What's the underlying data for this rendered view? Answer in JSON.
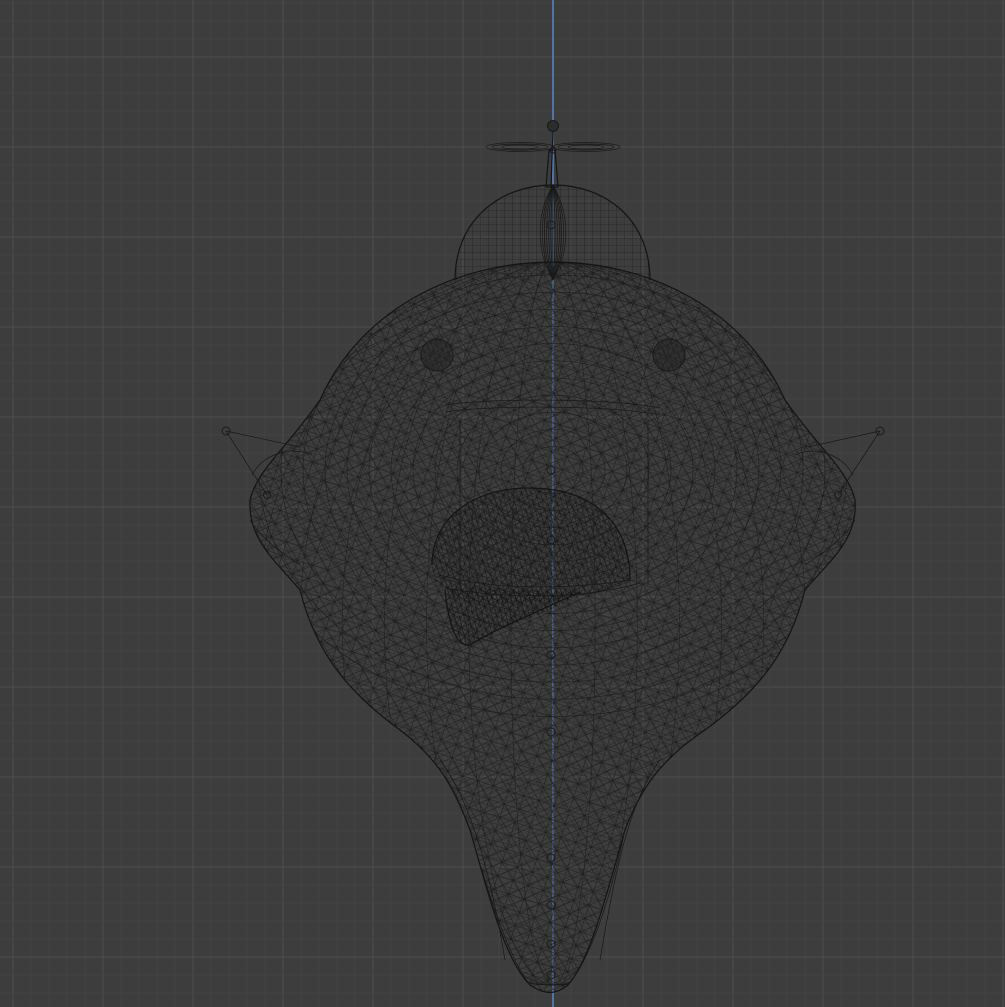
{
  "viewport": {
    "view": "3d-viewport",
    "shading": "wireframe",
    "background_color": "#3d3d3d",
    "grid_color": "#4a4a4a",
    "axis_color": "#5a86c8",
    "wire_color": "#1a1a1a"
  },
  "model": {
    "object": "character-head-mesh",
    "parts": [
      "propeller",
      "cap",
      "head",
      "left-eye",
      "right-eye",
      "left-ear",
      "right-ear",
      "beak",
      "tongue",
      "chin"
    ]
  }
}
